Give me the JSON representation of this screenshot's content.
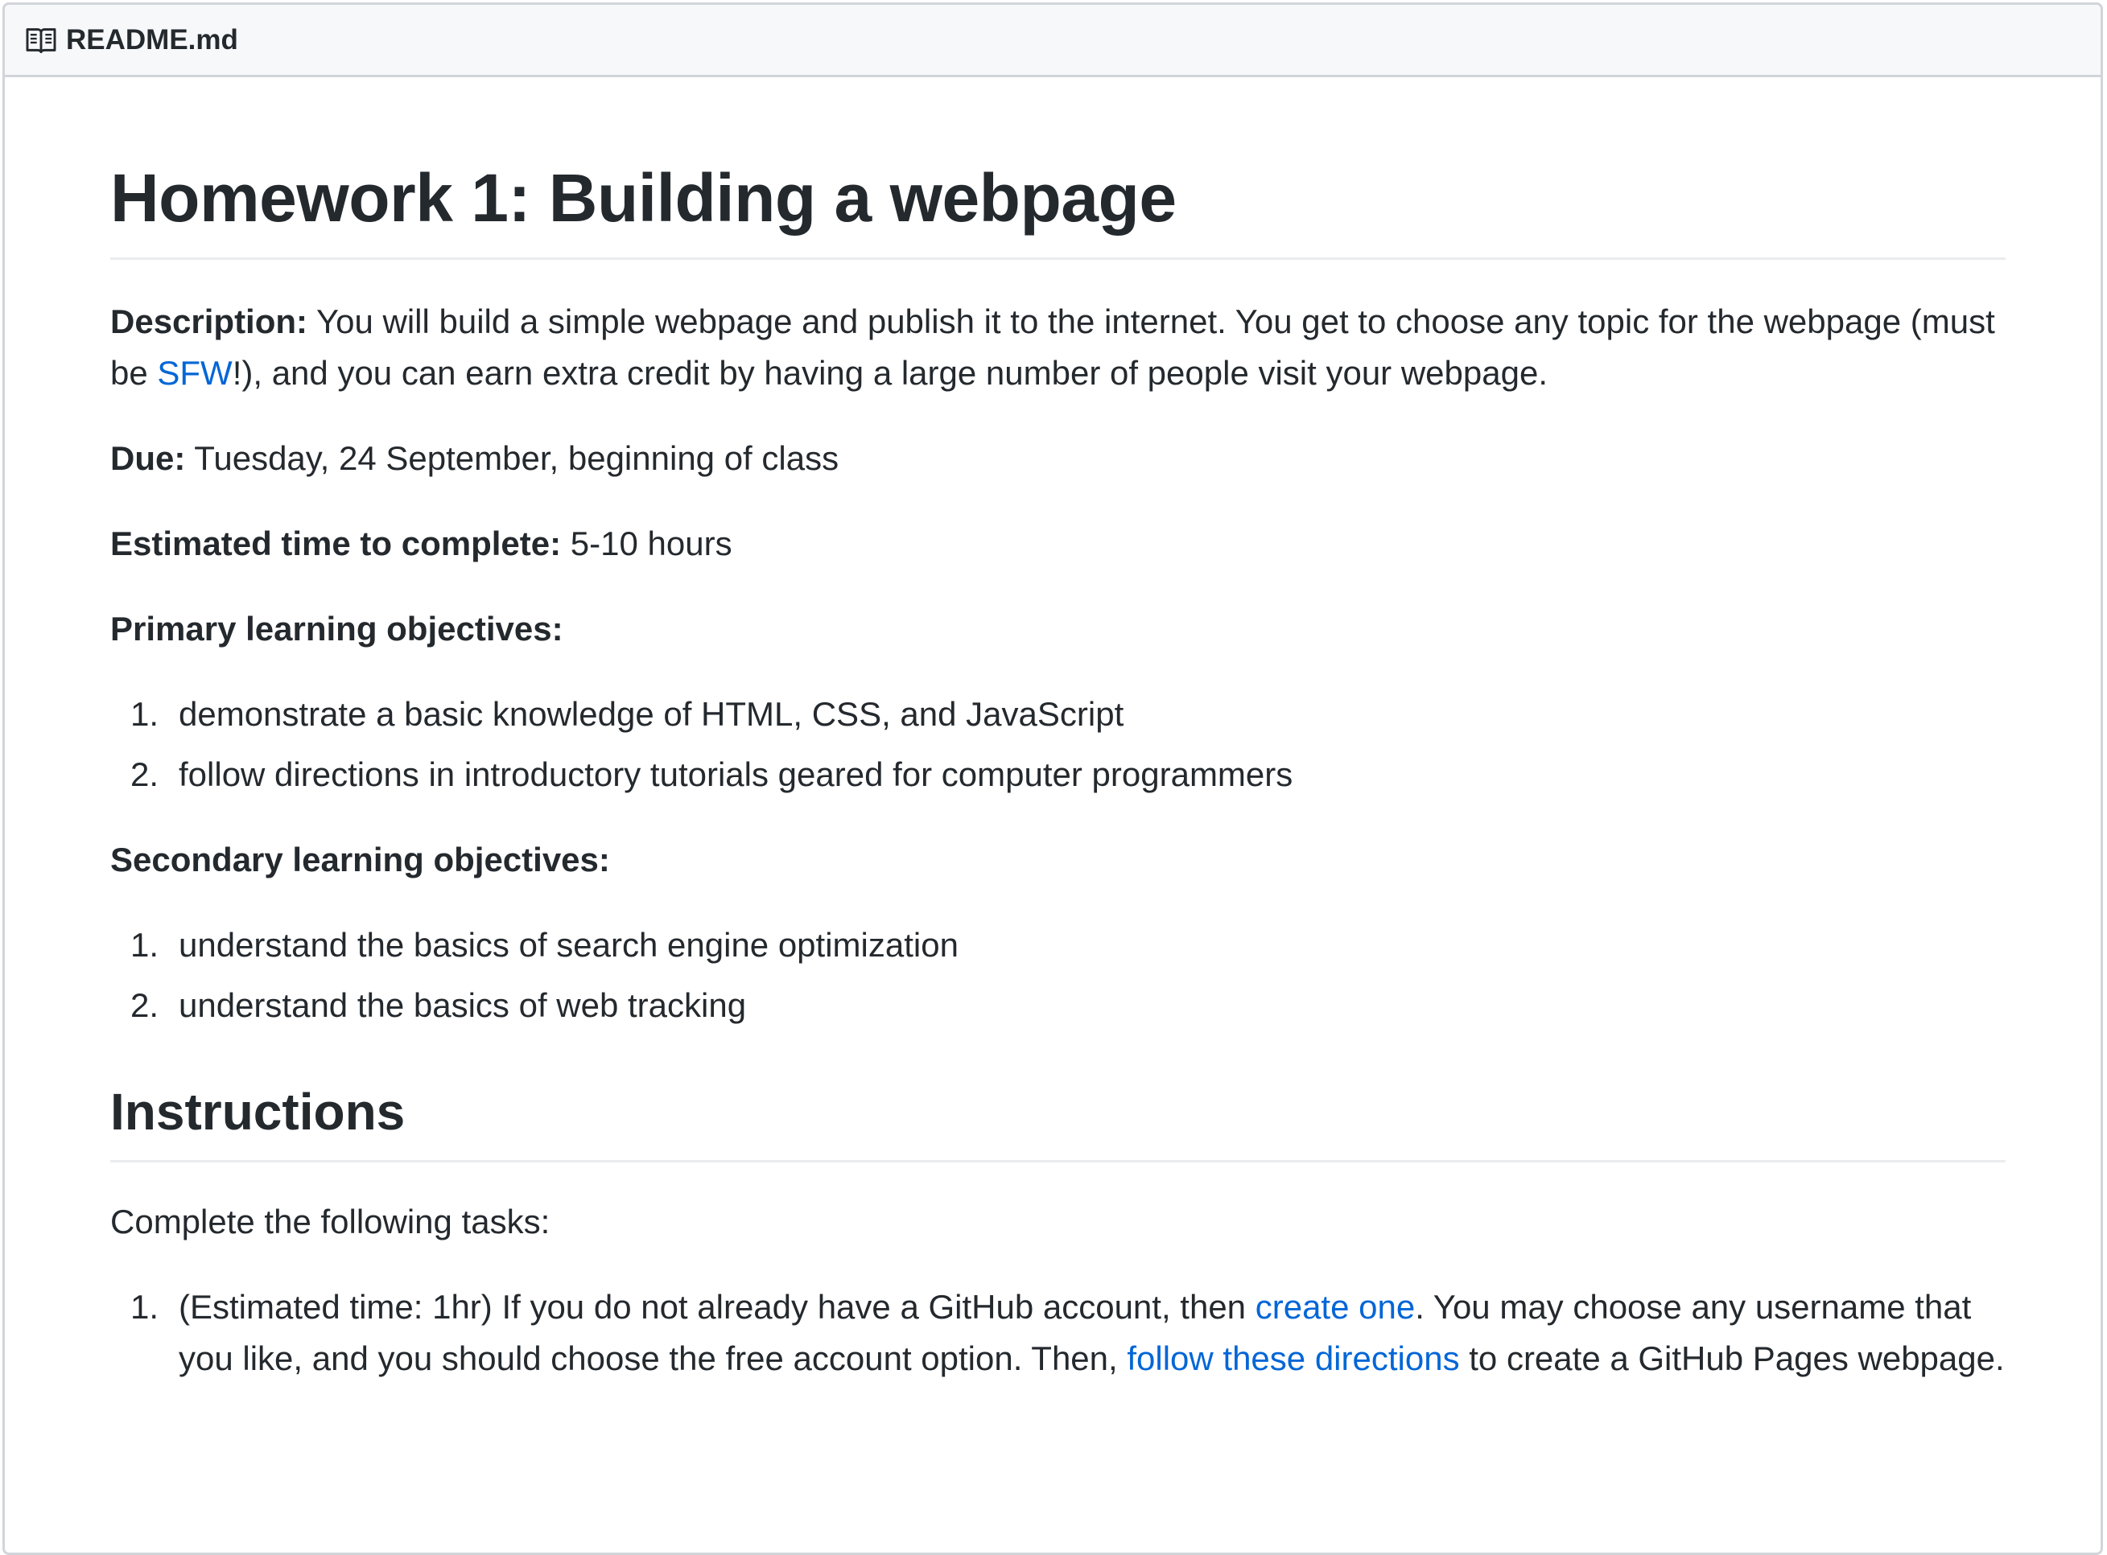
{
  "file_header": {
    "icon": "book-icon",
    "filename": "README.md"
  },
  "readme": {
    "title": "Homework 1: Building a webpage",
    "description": {
      "label": "Description:",
      "text_1": " You will build a simple webpage and publish it to the internet. You get to choose any topic for the webpage (must be ",
      "link_sfw": "SFW",
      "text_2": "!), and you can earn extra credit by having a large number of people visit your webpage."
    },
    "due": {
      "label": "Due:",
      "value": " Tuesday, 24 September, beginning of class"
    },
    "estimated": {
      "label": "Estimated time to complete:",
      "value": " 5-10 hours"
    },
    "primary": {
      "label": "Primary learning objectives:",
      "items": [
        {
          "num": "1.",
          "text": "demonstrate a basic knowledge of HTML, CSS, and JavaScript"
        },
        {
          "num": "2.",
          "text": "follow directions in introductory tutorials geared for computer programmers"
        }
      ]
    },
    "secondary": {
      "label": "Secondary learning objectives:",
      "items": [
        {
          "num": "1.",
          "text": "understand the basics of search engine optimization"
        },
        {
          "num": "2.",
          "text": "understand the basics of web tracking"
        }
      ]
    },
    "instructions": {
      "heading": "Instructions",
      "intro": "Complete the following tasks:",
      "tasks": [
        {
          "num": "1.",
          "text_1": "(Estimated time: 1hr) If you do not already have a GitHub account, then ",
          "link_1": "create one",
          "text_2": ". You may choose any username that you like, and you should choose the free account option. Then, ",
          "link_2": "follow these directions",
          "text_3": " to create a GitHub Pages webpage."
        }
      ]
    }
  }
}
